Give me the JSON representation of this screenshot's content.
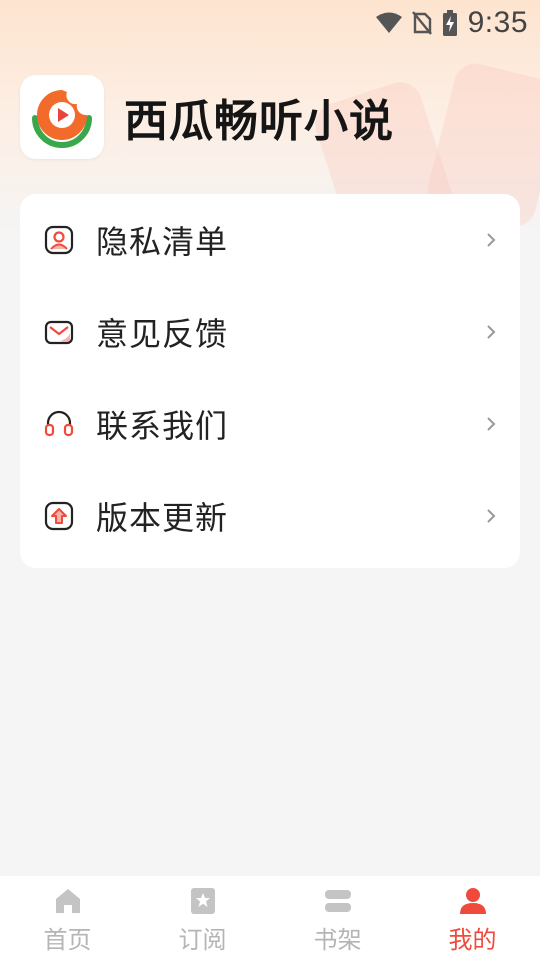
{
  "status_bar": {
    "time": "9:35",
    "icons": [
      "wifi-icon",
      "no-sim-icon",
      "battery-charging-icon"
    ]
  },
  "app": {
    "name": "西瓜畅听小说",
    "logo": "watermelon-play-logo"
  },
  "menu": {
    "items": [
      {
        "label": "隐私清单",
        "icon": "privacy-icon"
      },
      {
        "label": "意见反馈",
        "icon": "mail-icon"
      },
      {
        "label": "联系我们",
        "icon": "headset-icon"
      },
      {
        "label": "版本更新",
        "icon": "update-icon"
      }
    ]
  },
  "bottom_nav": {
    "items": [
      {
        "label": "首页",
        "icon": "home-icon"
      },
      {
        "label": "订阅",
        "icon": "bookmark-star-icon"
      },
      {
        "label": "书架",
        "icon": "bookshelf-icon"
      },
      {
        "label": "我的",
        "icon": "user-icon",
        "active": true
      }
    ]
  },
  "colors": {
    "accent": "#f04a3d",
    "nav_inactive": "#b5b5b5",
    "logo_orange": "#f26b2a",
    "logo_green": "#3aa84a"
  }
}
